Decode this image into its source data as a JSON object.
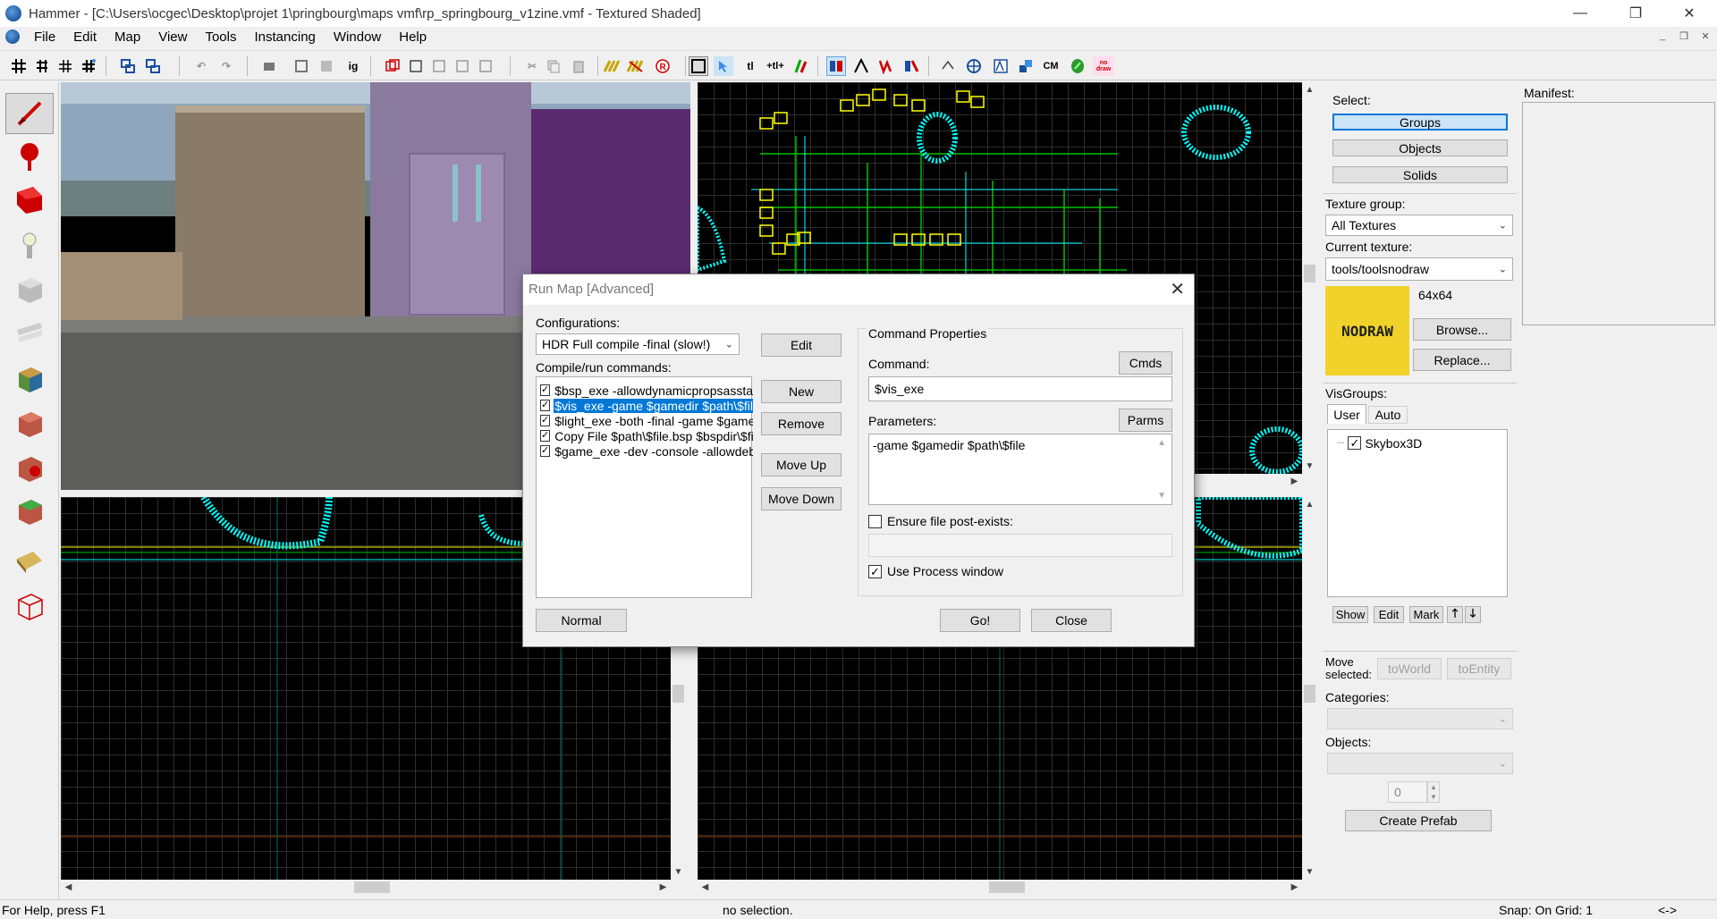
{
  "window": {
    "title": "Hammer - [C:\\Users\\ocgec\\Desktop\\projet 1\\pringbourg\\maps vmf\\rp_springbourg_v1zine.vmf - Textured Shaded]",
    "minimize": "—",
    "restore": "❐",
    "close": "✕"
  },
  "menu": [
    "File",
    "Edit",
    "Map",
    "View",
    "Tools",
    "Instancing",
    "Window",
    "Help"
  ],
  "toolbar": {
    "text_buttons": {
      "ig": "ig",
      "tl": "tl",
      "tl2": "+tl+",
      "cm": "CM",
      "nodraw": "no draw"
    }
  },
  "dialog": {
    "title": "Run Map [Advanced]",
    "configurations_label": "Configurations:",
    "configuration_value": "HDR Full compile -final (slow!)",
    "edit_label": "Edit",
    "compile_label": "Compile/run commands:",
    "commands": [
      {
        "text": "$bsp_exe -allowdynamicpropsasstatic",
        "checked": true,
        "selected": false
      },
      {
        "text": "$vis_exe -game $gamedir $path\\$file",
        "checked": true,
        "selected": true
      },
      {
        "text": "$light_exe -both -final -game $gamedir",
        "checked": true,
        "selected": false
      },
      {
        "text": "Copy File $path\\$file.bsp $bspdir\\$file",
        "checked": true,
        "selected": false
      },
      {
        "text": "$game_exe -dev -console -allowdebug",
        "checked": true,
        "selected": false
      }
    ],
    "new_label": "New",
    "remove_label": "Remove",
    "move_up_label": "Move Up",
    "move_down_label": "Move Down",
    "normal_label": "Normal",
    "command_properties_label": "Command Properties",
    "command_label": "Command:",
    "cmds_label": "Cmds",
    "command_value": "$vis_exe",
    "parameters_label": "Parameters:",
    "parms_label": "Parms",
    "parameters_value": "-game $gamedir $path\\$file",
    "ensure_label": "Ensure file post-exists:",
    "ensure_checked": false,
    "use_process_label": "Use Process window",
    "use_process_checked": true,
    "go_label": "Go!",
    "close_label": "Close"
  },
  "right_panel": {
    "select_label": "Select:",
    "groups_label": "Groups",
    "objects_label": "Objects",
    "solids_label": "Solids",
    "texture_group_label": "Texture group:",
    "texture_group_value": "All Textures",
    "current_texture_label": "Current texture:",
    "current_texture_value": "tools/toolsnodraw",
    "texture_size": "64x64",
    "texture_preview_text": "NODRAW",
    "browse_label": "Browse...",
    "replace_label": "Replace...",
    "visgroups_label": "VisGroups:",
    "tab_user": "User",
    "tab_auto": "Auto",
    "visgroup_item": "Skybox3D",
    "visgroup_checked": true,
    "show_label": "Show",
    "edit_label": "Edit",
    "mark_label": "Mark",
    "move_selected_label": "Move selected:",
    "to_world_label": "toWorld",
    "to_entity_label": "toEntity",
    "categories_label": "Categories:",
    "objects_list_label": "Objects:",
    "count_value": "0",
    "create_prefab_label": "Create Prefab",
    "manifest_label": "Manifest:"
  },
  "status": {
    "help": "For Help, press F1",
    "selection": "no selection.",
    "snap": "Snap: On Grid: 1",
    "extra": "<->"
  },
  "colors": {
    "selection_blue": "#0078d7",
    "nodraw_yellow": "#f1d22a",
    "wire_cyan": "#00ffff",
    "wire_yellow": "#ffff00",
    "wire_green": "#00c000"
  }
}
